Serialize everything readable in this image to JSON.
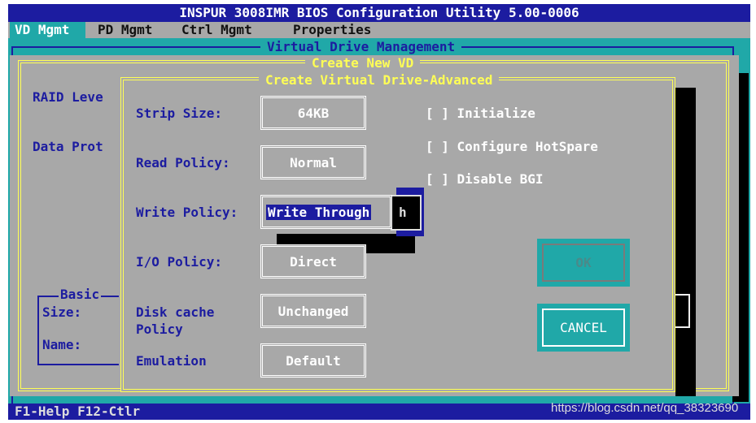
{
  "title": "INSPUR 3008IMR BIOS Configuration Utility 5.00-0006",
  "menu": [
    "VD Mgmt",
    "PD Mgmt",
    "Ctrl Mgmt",
    "Properties"
  ],
  "frame_title": "Virtual Drive Management",
  "create_title": "Create New VD",
  "dialog_title": "Create Virtual Drive-Advanced",
  "left": {
    "raid": "RAID Leve",
    "data": "Data Prot",
    "basic": "Basic",
    "size": "Size:",
    "name": "Name:"
  },
  "fields": [
    {
      "label": "Strip Size:",
      "value": "64KB"
    },
    {
      "label": "Read Policy:",
      "value": "Normal"
    },
    {
      "label": "Write Policy:",
      "value": "Write Through"
    },
    {
      "label": "I/O Policy:",
      "value": "Direct"
    },
    {
      "label": "Disk cache Policy",
      "value": "Unchanged"
    },
    {
      "label": "Emulation",
      "value": "Default"
    }
  ],
  "dropdown_fragment": "h",
  "checkboxes": [
    {
      "label": "[ ] Initialize",
      "checked": false
    },
    {
      "label": "[ ] Configure HotSpare",
      "checked": false
    },
    {
      "label": "[ ] Disable BGI",
      "checked": false
    }
  ],
  "buttons": {
    "ok": "OK",
    "cancel": "CANCEL"
  },
  "status": "F1-Help F12-Ctlr",
  "watermark": "https://blog.csdn.net/qq_38323690",
  "colors": {
    "blue": "#1c1ca0",
    "gray": "#a8a8a8",
    "teal": "#20a8a8",
    "yellow": "#ffff55"
  }
}
